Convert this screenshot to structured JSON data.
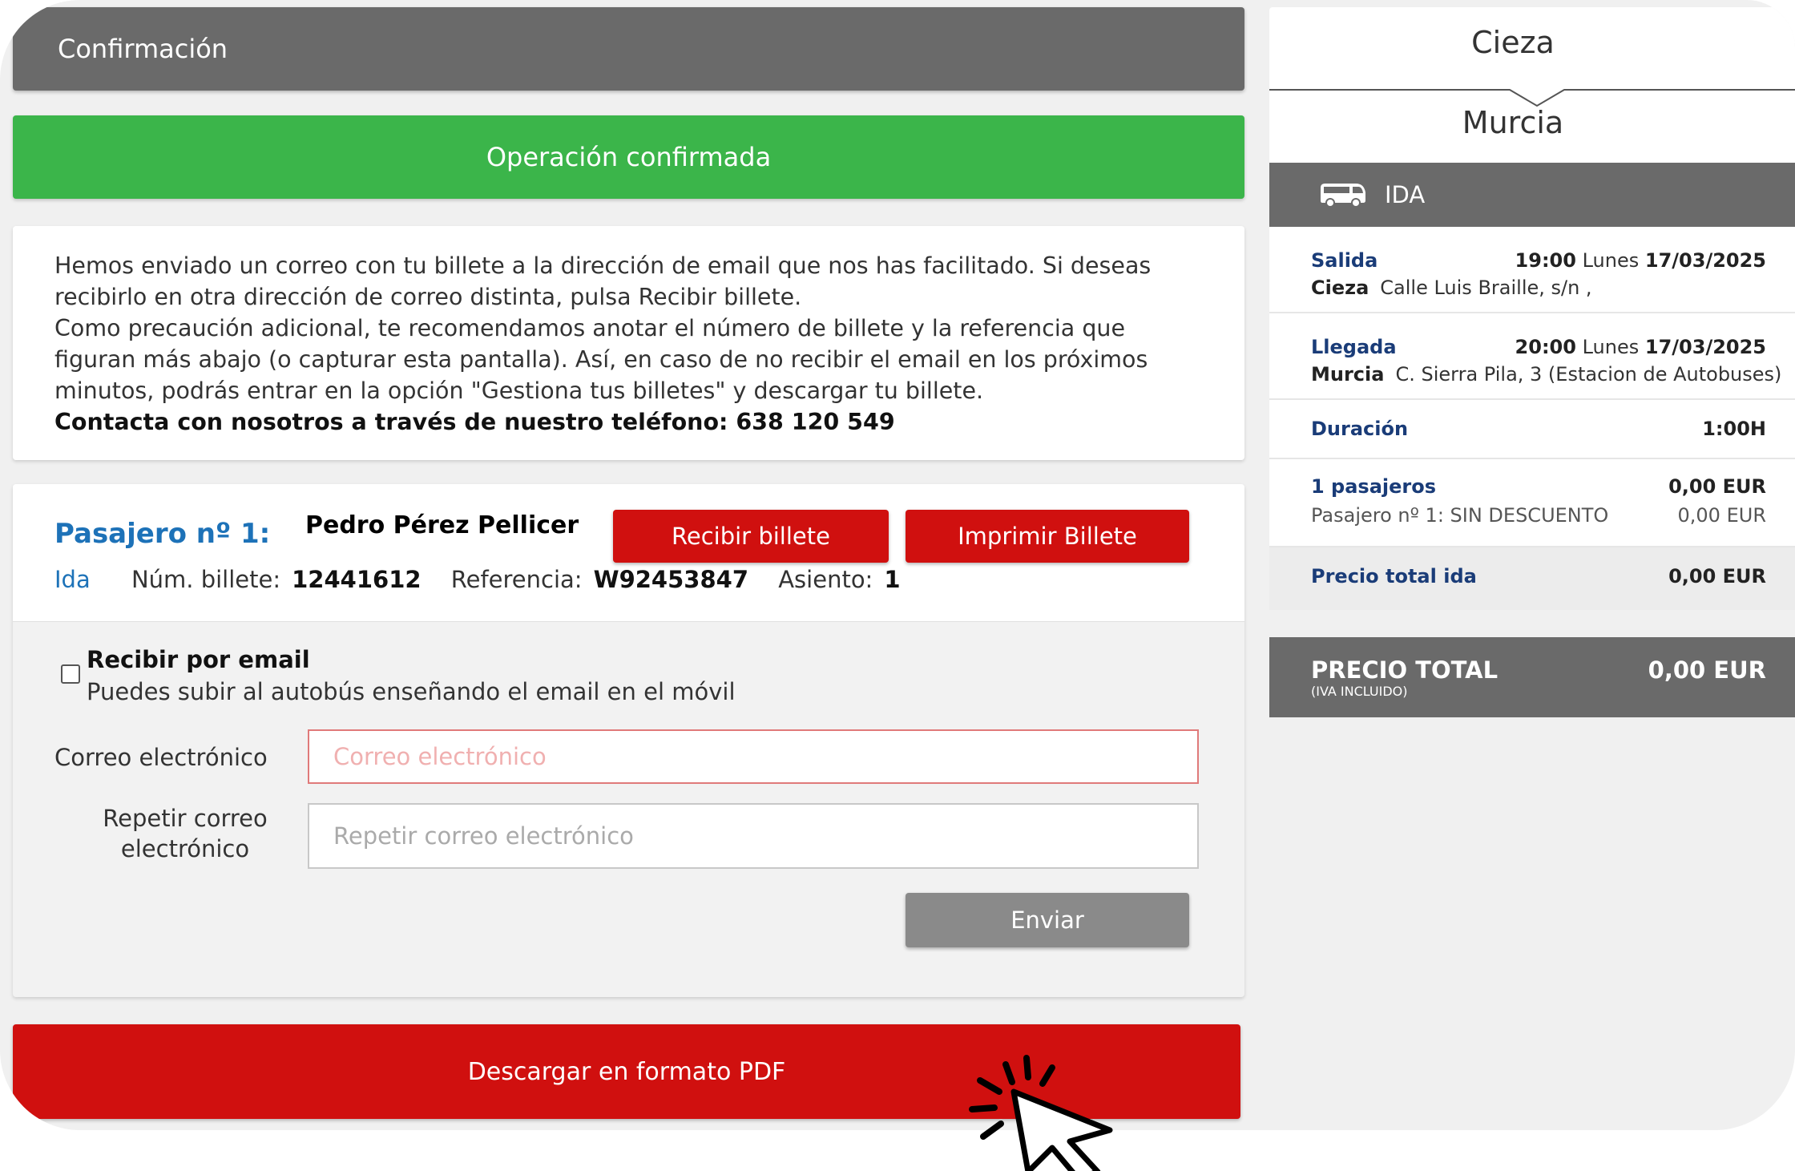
{
  "header": {
    "title": "Confirmación"
  },
  "status": {
    "message": "Operación confirmada"
  },
  "info": {
    "p1": "Hemos enviado un correo con tu billete a la dirección de email que nos has facilitado. Si deseas recibirlo en otra dirección de correo distinta, pulsa Recibir billete.",
    "p2": "Como precaución adicional, te recomendamos anotar el número de billete y la referencia que figuran más abajo (o capturar esta pantalla). Así, en caso de no recibir el email en los próximos minutos, podrás entrar en la opción \"Gestiona tus billetes\" y descargar tu billete.",
    "p3": "Contacta con nosotros a través de nuestro teléfono: 638 120 549"
  },
  "passenger": {
    "label": "Pasajero nº 1:",
    "name": "Pedro Pérez Pellicer",
    "receive_button": "Recibir billete",
    "print_button": "Imprimir Billete",
    "direction": "Ida",
    "ticket_label": "Núm. billete:",
    "ticket_number": "12441612",
    "reference_label": "Referencia:",
    "reference": "W92453847",
    "seat_label": "Asiento:",
    "seat": "1"
  },
  "email_form": {
    "checkbox_label": "Recibir por email",
    "checkbox_hint": "Puedes subir al autobús enseñando el email en el móvil",
    "email_label": "Correo electrónico",
    "email_placeholder": "Correo electrónico",
    "repeat_label": "Repetir correo electrónico",
    "repeat_placeholder": "Repetir correo electrónico",
    "send_button": "Enviar"
  },
  "pdf_button": "Descargar en formato PDF",
  "summary": {
    "origin": "Cieza",
    "destination": "Murcia",
    "leg": "IDA",
    "departure": {
      "label": "Salida",
      "time": "19:00",
      "day": "Lunes",
      "date": "17/03/2025",
      "city": "Cieza",
      "address": "Calle Luis Braille, s/n ,"
    },
    "arrival": {
      "label": "Llegada",
      "time": "20:00",
      "day": "Lunes",
      "date": "17/03/2025",
      "city": "Murcia",
      "address": "C. Sierra Pila, 3 (Estacion de Autobuses)"
    },
    "duration_label": "Duración",
    "duration": "1:00H",
    "passengers_label": "1 pasajeros",
    "passengers_price": "0,00 EUR",
    "passenger_detail": "Pasajero nº 1: SIN DESCUENTO",
    "passenger_detail_price": "0,00 EUR",
    "total_ida_label": "Precio total ida",
    "total_ida": "0,00 EUR",
    "total_label": "PRECIO TOTAL",
    "total_note": "(IVA INCLUIDO)",
    "total": "0,00 EUR"
  },
  "colors": {
    "header_grey": "#6a6a6a",
    "success_green": "#3bb54a",
    "action_red": "#d0100f",
    "link_blue": "#1d72b8",
    "navy": "#1a3c78"
  },
  "icons": [
    "bus-icon",
    "click-cursor-icon"
  ]
}
